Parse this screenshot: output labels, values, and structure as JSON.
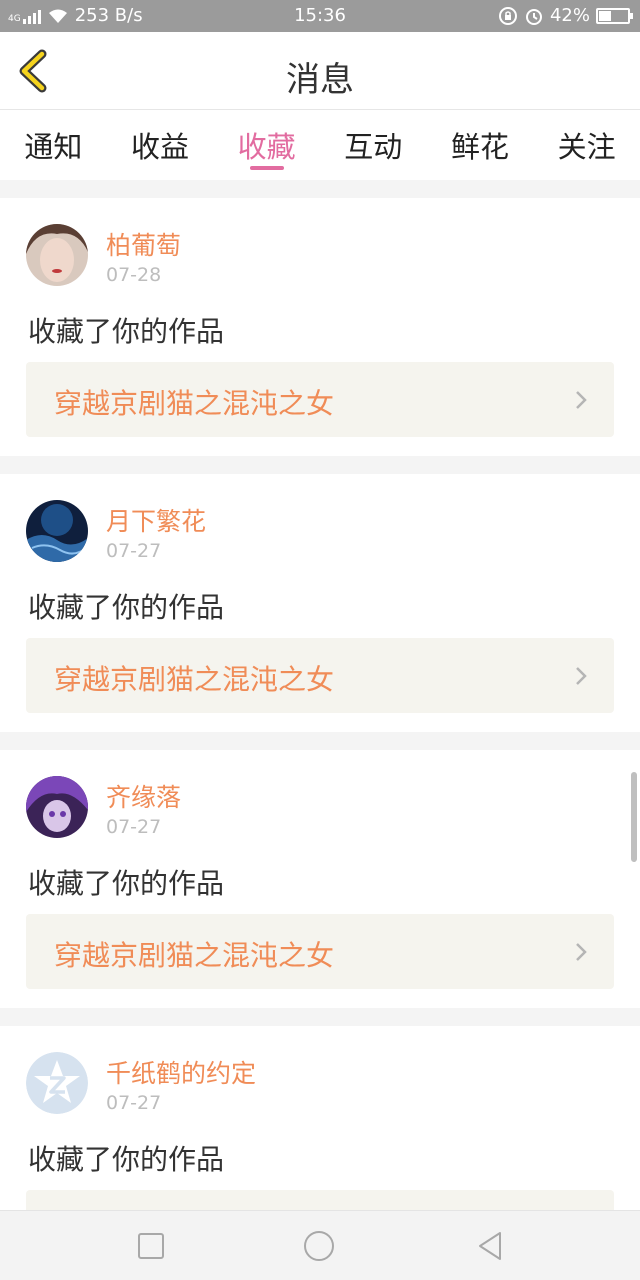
{
  "status_bar": {
    "network": "4G",
    "speed": "253 B/s",
    "time": "15:36",
    "battery": "42%"
  },
  "header": {
    "title": "消息"
  },
  "tabs": [
    {
      "label": "通知"
    },
    {
      "label": "收益"
    },
    {
      "label": "收藏",
      "active": true
    },
    {
      "label": "互动"
    },
    {
      "label": "鲜花"
    },
    {
      "label": "关注"
    }
  ],
  "messages": [
    {
      "username": "柏葡萄",
      "date": "07-28",
      "action": "收藏了你的作品",
      "work_title": "穿越京剧猫之混沌之女"
    },
    {
      "username": "月下繁花",
      "date": "07-27",
      "action": "收藏了你的作品",
      "work_title": "穿越京剧猫之混沌之女"
    },
    {
      "username": "齐缘落",
      "date": "07-27",
      "action": "收藏了你的作品",
      "work_title": "穿越京剧猫之混沌之女"
    },
    {
      "username": "千纸鹤的约定",
      "date": "07-27",
      "action": "收藏了你的作品",
      "work_title": ""
    }
  ],
  "colors": {
    "accent": "#e26ca0",
    "username": "#f08c57",
    "work_bg": "#f5f4ee"
  }
}
